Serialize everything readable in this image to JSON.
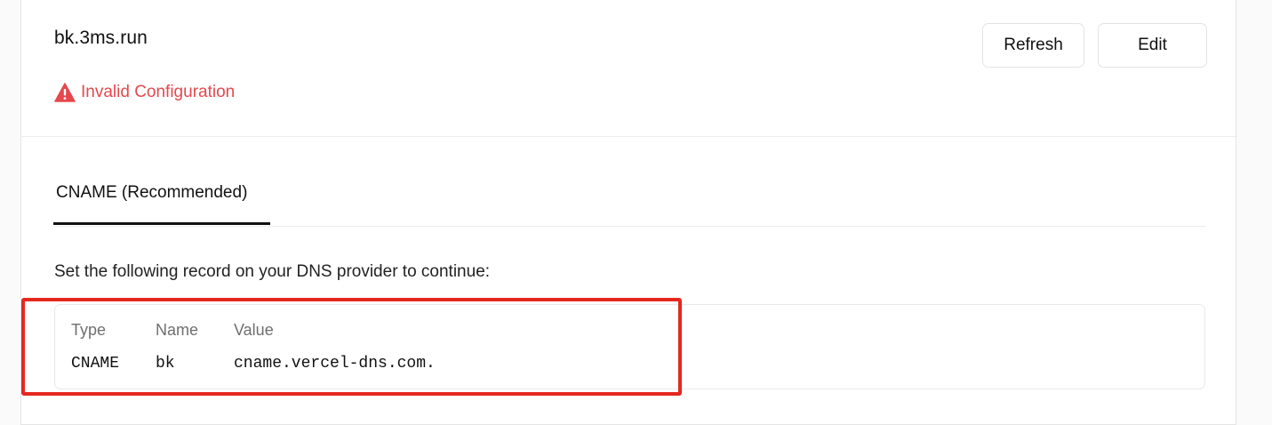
{
  "domain": {
    "name": "bk.3ms.run",
    "status_text": "Invalid Configuration",
    "status_icon": "warning-triangle-icon",
    "status_color": "#e5484d"
  },
  "actions": {
    "refresh_label": "Refresh",
    "edit_label": "Edit"
  },
  "tabs": [
    {
      "label": "CNAME (Recommended)",
      "active": true
    }
  ],
  "instructions": "Set the following record on your DNS provider to continue:",
  "records": {
    "headers": {
      "type": "Type",
      "name": "Name",
      "value": "Value"
    },
    "rows": [
      {
        "type": "CNAME",
        "name": "bk",
        "value": "cname.vercel-dns.com."
      }
    ]
  },
  "highlight_color": "#e5281f"
}
